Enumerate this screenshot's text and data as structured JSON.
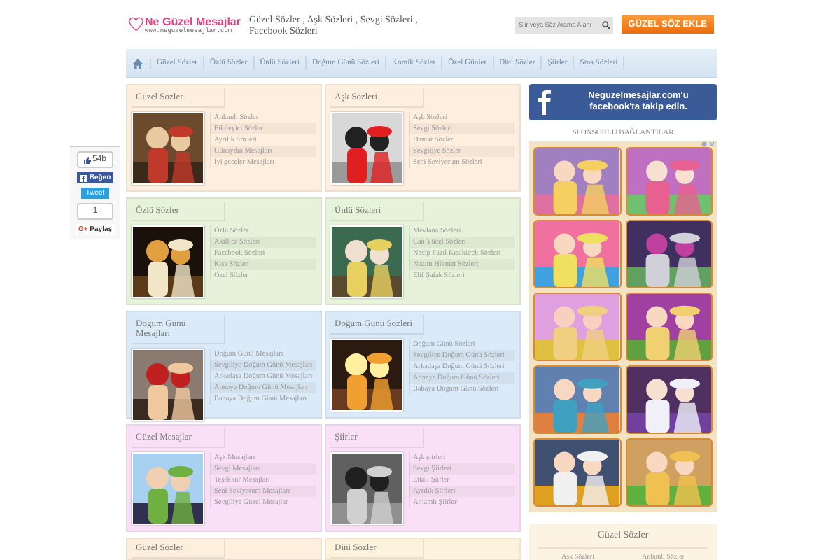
{
  "header": {
    "logo_title": "Ne Güzel Mesajlar",
    "logo_url": "www.neguzelmesajlar.com",
    "tagline": "Güzel Sözler , Aşk Sözleri , Sevgi Sözleri , Facebook Sözleri",
    "search": {
      "placeholder": "Şiir veya Söz Arama Alanı"
    },
    "add_button": "GÜZEL SÖZ EKLE"
  },
  "nav": [
    "Güzel Sözler",
    "Özlü Sözler",
    "Ünlü Sözleri",
    "Doğum Günü Sözleri",
    "Komik Sözler",
    "Özel Günler",
    "Dini Sözler",
    "Şiirler",
    "Sms Sözleri"
  ],
  "social": {
    "like_count": "54b",
    "like": "Beğen",
    "tweet": "Tweet",
    "share_count": "1",
    "share_icon": "G+",
    "share": "Paylaş"
  },
  "categories": [
    {
      "title": "Güzel Sözler",
      "color": "#fdeedd",
      "links": [
        "Anlamlı Sözler",
        "Etkileyici Sözler",
        "Ayrılık Sözleri",
        "Günaydın Mesajları",
        "İyi geceler Mesajları"
      ]
    },
    {
      "title": "Aşk Sözleri",
      "color": "#fdeedd",
      "links": [
        "Aşk Sözleri",
        "Sevgi Sözleri",
        "Damar Sözler",
        "Sevgiliye Sözler",
        "Seni Seviyorum Sözleri"
      ]
    },
    {
      "title": "Özlü Sözler",
      "color": "#e6f2da",
      "links": [
        "Özlü Sözler",
        "Akıllıca Sözleri",
        "Facebook Sözleri",
        "Kısa Sözler",
        "Özel Sözler"
      ]
    },
    {
      "title": "Ünlü Sözleri",
      "color": "#e6f2da",
      "links": [
        "Mevlana Sözleri",
        "Can Yücel Sözleri",
        "Necip Fazıl Kısakürek Sözleri",
        "Nazım Hikmet Sözleri",
        "Elif Şafak Sözleri"
      ]
    },
    {
      "title": "Doğum Günü Mesajları",
      "color": "#dbeaf8",
      "links": [
        "Doğum Günü Mesajları",
        "Sevgiliye Doğum Günü Mesajları",
        "Arkadaşa Doğum Günü Mesajları",
        "Anneye Doğum Günü Mesajları",
        "Babaya Doğum Günü Mesajları"
      ]
    },
    {
      "title": "Doğum Günü Sözleri",
      "color": "#dbeaf8",
      "links": [
        "Doğum Günü Sözleri",
        "Sevgiliye Doğum Günü Sözleri",
        "Arkadaşa Doğum Günü Sözleri",
        "Anneye Doğum Günü Sözleri",
        "Babaya Doğum Günü Sözleri"
      ]
    },
    {
      "title": "Güzel Mesajlar",
      "color": "#f9e0f6",
      "links": [
        "Aşk Mesajları",
        "Sevgi Mesajları",
        "Teşekkür Mesajları",
        "Seni Seviyorum Mesajları",
        "Sevgiliye Güzel Mesajlar"
      ]
    },
    {
      "title": "Şiirler",
      "color": "#f9e0f6",
      "links": [
        "Aşk şiirleri",
        "Sevgi Şiirleri",
        "Etkili Şiirler",
        "Ayrılık Şiirleri",
        "Anlamlı Şiirler"
      ]
    },
    {
      "title": "Güzel Sözler",
      "color": "#fdeedd"
    },
    {
      "title": "Dini Sözler",
      "color": "#fdf3dc"
    }
  ],
  "sidebar": {
    "facebook_banner": [
      "Neguzelmesajlar.com'u",
      "facebook'ta takip edin."
    ],
    "sponsored_title": "SPONSORLU BAĞLANTILAR",
    "box": {
      "title": "Güzel Sözler",
      "links": [
        "Aşk Sözleri",
        "Anlamlı Sözler"
      ]
    }
  }
}
